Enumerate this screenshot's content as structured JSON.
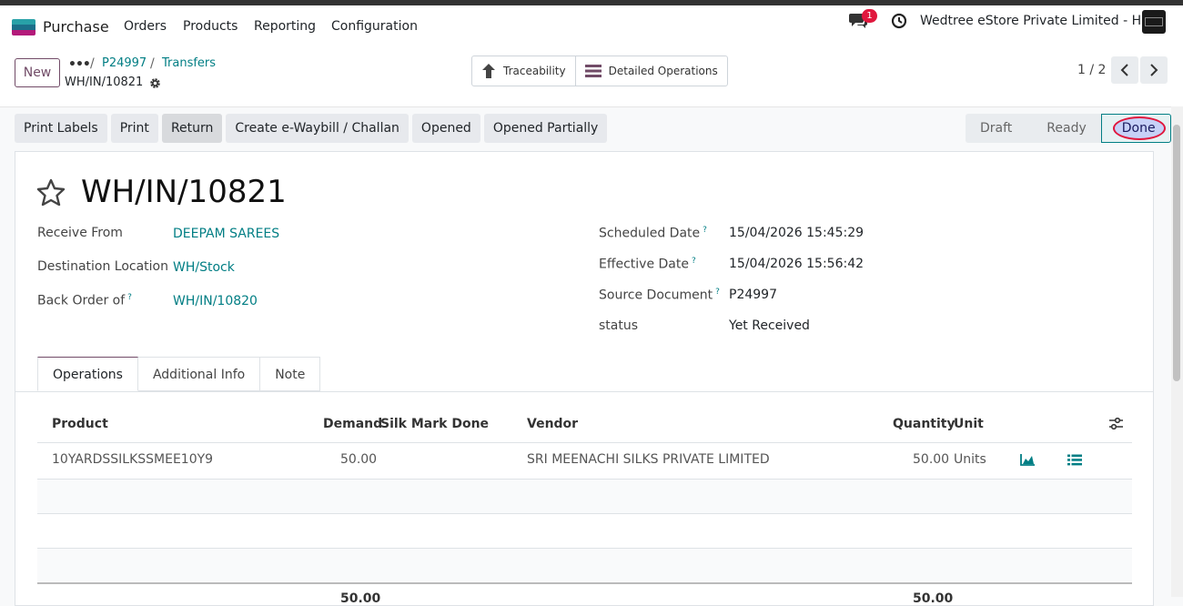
{
  "navbar": {
    "app_name": "Purchase",
    "menu": [
      "Orders",
      "Products",
      "Reporting",
      "Configuration"
    ],
    "chat_badge": "1",
    "company": "Wedtree eStore Private Limited - HO",
    "colors": {
      "logo_top": "#28a1a8",
      "logo_mid": "#1b6f89",
      "logo_bot": "#b31a7a"
    }
  },
  "control": {
    "new_label": "New",
    "breadcrumb_dots": "•••",
    "breadcrumb": [
      "P24997",
      "Transfers"
    ],
    "record_name": "WH/IN/10821",
    "smart_buttons": [
      "Traceability",
      "Detailed Operations"
    ],
    "pager": "1 / 2"
  },
  "actions": [
    "Print Labels",
    "Print",
    "Return",
    "Create e-Waybill / Challan",
    "Opened",
    "Opened Partially"
  ],
  "status": [
    "Draft",
    "Ready",
    "Done"
  ],
  "form": {
    "title": "WH/IN/10821",
    "left": [
      {
        "label": "Receive From",
        "value": "DEEPAM SAREES",
        "help": ""
      },
      {
        "label": "Destination Location",
        "value": "WH/Stock",
        "help": ""
      },
      {
        "label": "Back Order of",
        "value": "WH/IN/10820",
        "help": "?"
      }
    ],
    "right": [
      {
        "label": "Scheduled Date",
        "value": "15/04/2026 15:45:29",
        "help": "?"
      },
      {
        "label": "Effective Date",
        "value": "15/04/2026 15:56:42",
        "help": "?"
      },
      {
        "label": "Source Document",
        "value": "P24997",
        "help": "?"
      },
      {
        "label": "status",
        "value": "Yet Received",
        "help": ""
      }
    ]
  },
  "tabs": [
    "Operations",
    "Additional Info",
    "Note"
  ],
  "table": {
    "headers": {
      "product": "Product",
      "demand": "Demand",
      "silk": "Silk Mark Done",
      "vendor": "Vendor",
      "quantity": "Quantity",
      "unit": "Unit"
    },
    "rows": [
      {
        "product": "10YARDSSILKSSMEE10Y9",
        "demand": "50.00",
        "silk": "",
        "vendor": "SRI MEENACHI SILKS PRIVATE LIMITED",
        "quantity": "50.00",
        "unit": "Units"
      }
    ],
    "totals": {
      "demand": "50.00",
      "quantity": "50.00"
    }
  }
}
